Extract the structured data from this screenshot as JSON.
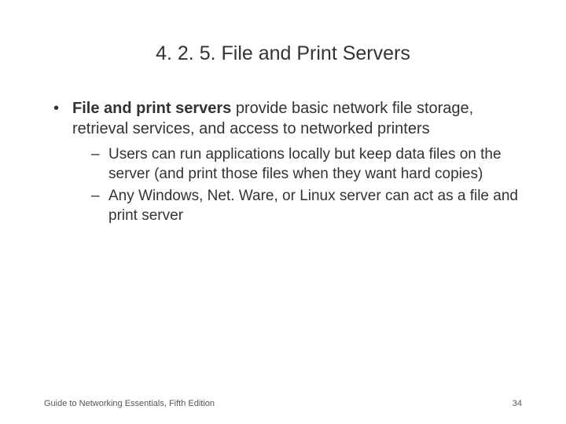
{
  "title": "4. 2. 5. File and Print Servers",
  "bullet": {
    "bold": "File and print servers",
    "rest": " provide basic network file storage, retrieval services, and access to networked printers",
    "subs": [
      "Users can run applications locally but keep data files on the server (and print those files when they want hard copies)",
      "Any Windows, Net. Ware, or Linux server can act as a file and print server"
    ]
  },
  "footer": {
    "left": "Guide to Networking Essentials, Fifth Edition",
    "right": "34"
  }
}
